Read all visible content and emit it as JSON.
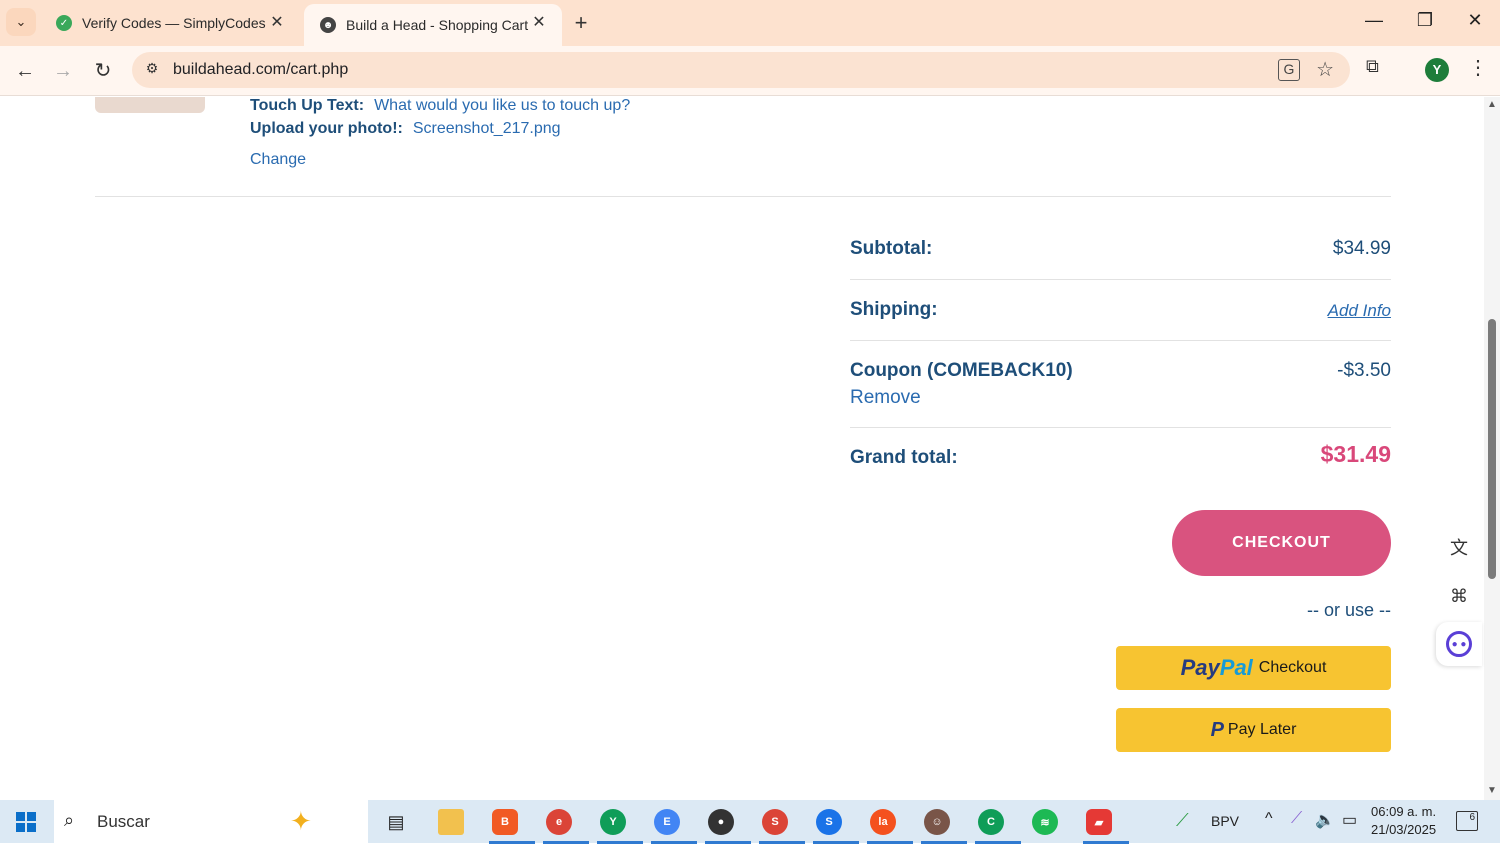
{
  "browser": {
    "tabs": [
      {
        "title": "Verify Codes — SimplyCodes",
        "active": false
      },
      {
        "title": "Build a Head - Shopping Cart",
        "active": true
      }
    ],
    "url": "buildahead.com/cart.php"
  },
  "profile": {
    "initial": "Y"
  },
  "cart_item": {
    "touch_up_label": "Touch Up Text:",
    "touch_up_value": "What would you like us to touch up?",
    "upload_label": "Upload your photo!:",
    "upload_value": "Screenshot_217.png",
    "change_link": "Change"
  },
  "summary": {
    "subtotal_label": "Subtotal:",
    "subtotal_value": "$34.99",
    "shipping_label": "Shipping:",
    "shipping_value": "Add Info",
    "coupon_label": "Coupon (COMEBACK10)",
    "coupon_value": "-$3.50",
    "coupon_remove": "Remove",
    "grand_total_label": "Grand total:",
    "grand_total_value": "$31.49"
  },
  "actions": {
    "checkout": "CHECKOUT",
    "or_use": "-- or use --",
    "paypal_logo_1": "Pay",
    "paypal_logo_2": "Pal",
    "paypal_checkout": "Checkout",
    "pay_later": "Pay Later"
  },
  "taskbar": {
    "search_placeholder": "Buscar",
    "tray_label": "BPV",
    "time": "06:09 a. m.",
    "date": "21/03/2025",
    "notifications": "6"
  },
  "colors": {
    "accent_pink": "#d9537f",
    "heading_blue": "#1e4e79",
    "link_blue": "#2a6bb0",
    "paypal_yellow": "#f7c431",
    "chrome_tab_bg": "#fde2cf"
  }
}
